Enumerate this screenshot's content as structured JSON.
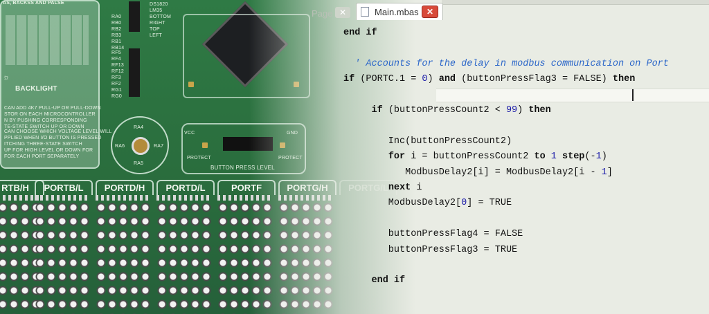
{
  "board": {
    "silk_top": "AS, BACKSS AND PALSE",
    "backlight": "BACKLIGHT",
    "dip_labels": [
      "RA0",
      "RB0",
      "RB2",
      "RB3",
      "RB1",
      "RB14",
      "RB15"
    ],
    "dip_labels2": [
      "RF5",
      "RF4",
      "RF13",
      "RF12",
      "RF3",
      "RF2",
      "RG1",
      "RG0"
    ],
    "dip_right_labels": [
      "DS1820",
      "LM35",
      "BOTTOM",
      "RIGHT",
      "TOP",
      "LEFT"
    ],
    "silk_note1": "CAN ADD 4K7 PULL-UP OR PULL-DOWN\nSTOR ON EACH MICROCONTROLLER\nN BY PUSHING CORRESPONDING\nTE-STATE SWITCH UP OR DOWN",
    "silk_note2": "CAN CHOOSE WHICH VOLTAGE LEVEL WILL\nPPLIED WHEN I/O BUTTON IS PRESSED\nITCHING THREE-STATE SWITCH\nUP FOR HIGH LEVEL OR DOWN FOR\nFOR EACH PORT SEPARATELY",
    "joystick_labels": [
      "RA4",
      "RA6",
      "RA7",
      "RA5"
    ],
    "button_press_level": "BUTTON PRESS LEVEL",
    "vcc": "VCC",
    "gnd": "GND",
    "protect": "PROTECT",
    "port_tabs": [
      "RTB/H",
      "PORTB/L",
      "PORTD/H",
      "PORTD/L",
      "PORTF",
      "PORTG/H",
      "PORTG/L"
    ]
  },
  "editor": {
    "tab_page_label": "Page",
    "tab_page_close": "✕",
    "tab_main_label": "Main.mbas",
    "tab_main_close": "✕",
    "lines": [
      {
        "faded": false,
        "html": "<span class=\"kw\">end if</span>"
      },
      {
        "faded": false,
        "html": ""
      },
      {
        "faded": false,
        "html": "  <span class=\"cm\">' Accounts for the delay in modbus communication on Port</span>"
      },
      {
        "faded": false,
        "html": "<span class=\"kw\">if</span> (PORTC.1 = <span class=\"num\">0</span>) <span class=\"kw\">and</span> (buttonPressFlag3 = FALSE) <span class=\"kw\">then</span>"
      },
      {
        "faded": false,
        "html": ""
      },
      {
        "faded": false,
        "html": "     <span class=\"kw\">if</span> (buttonPressCount2 &lt; <span class=\"num\">99</span>) <span class=\"kw\">then</span>"
      },
      {
        "faded": false,
        "html": ""
      },
      {
        "faded": false,
        "html": "        Inc(buttonPressCount2)"
      },
      {
        "faded": false,
        "html": "        <span class=\"kw\">for</span> i = buttonPressCount2 <span class=\"kw\">to</span> <span class=\"num\">1</span> <span class=\"kw\">step</span>(-<span class=\"num\">1</span>)"
      },
      {
        "faded": false,
        "html": "           ModbusDelay2[i] = ModbusDelay2[i - <span class=\"num\">1</span>]"
      },
      {
        "faded": false,
        "html": "        <span class=\"kw\">next</span> i"
      },
      {
        "faded": false,
        "html": "        ModbusDelay2[<span class=\"num\">0</span>] = TRUE"
      },
      {
        "faded": false,
        "html": ""
      },
      {
        "faded": false,
        "html": "        buttonPressFlag4 = FALSE"
      },
      {
        "faded": false,
        "html": "        buttonPressFlag3 = TRUE"
      },
      {
        "faded": false,
        "html": ""
      },
      {
        "faded": false,
        "html": "     <span class=\"kw\">end if</span>"
      }
    ]
  },
  "colors": {
    "board_green": "#2f7a45",
    "editor_bg": "#e9ece4",
    "comment": "#2c67c9",
    "close_red": "#d84a3a"
  }
}
